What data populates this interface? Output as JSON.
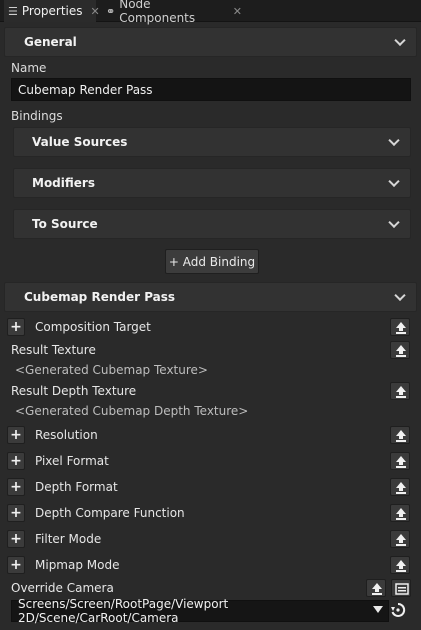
{
  "tabs": [
    {
      "label": "Properties",
      "close": "✕"
    },
    {
      "label": "Node Components",
      "close": "✕"
    }
  ],
  "general": {
    "header": "General",
    "name_label": "Name",
    "name_value": "Cubemap Render Pass",
    "bindings_label": "Bindings",
    "binding_sections": [
      "Value Sources",
      "Modifiers",
      "To Source"
    ],
    "add_binding": "+ Add Binding"
  },
  "cubemap": {
    "header": "Cubemap Render Pass",
    "composition_target": "Composition Target",
    "result_texture": "Result Texture",
    "result_texture_value": "<Generated Cubemap Texture>",
    "result_depth_texture": "Result Depth Texture",
    "result_depth_texture_value": "<Generated Cubemap Depth Texture>",
    "properties": [
      "Resolution",
      "Pixel Format",
      "Depth Format",
      "Depth Compare Function",
      "Filter Mode",
      "Mipmap Mode"
    ],
    "override_camera": "Override Camera",
    "camera_path": "Screens/Screen/RootPage/Viewport 2D/Scene/CarRoot/Camera"
  }
}
